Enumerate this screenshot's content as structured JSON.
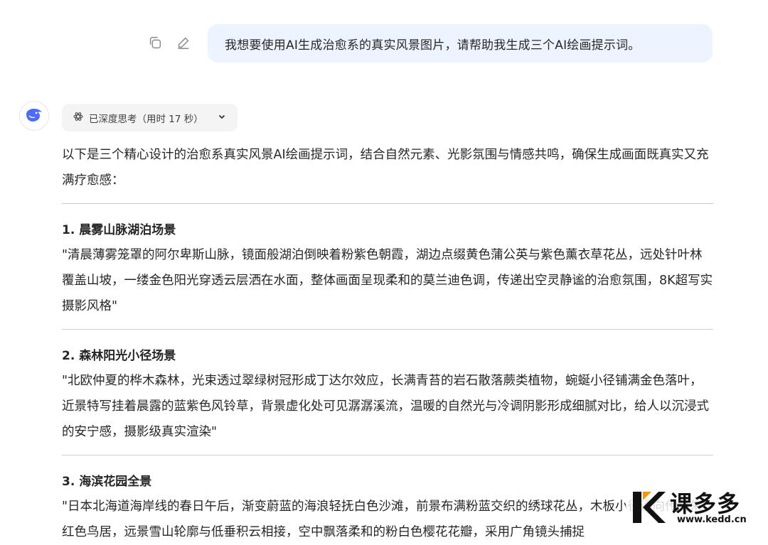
{
  "user_message": {
    "text": "我想要使用AI生成治愈系的真实风景图片，请帮助我生成三个AI绘画提示词。",
    "copy_icon": "copy-icon",
    "edit_icon": "edit-icon"
  },
  "assistant": {
    "avatar_icon": "whale-logo-icon",
    "thinking_label": "已深度思考（用时 17 秒）",
    "intro": "以下是三个精心设计的治愈系真实风景AI绘画提示词，结合自然元素、光影氛围与情感共鸣，确保生成画面既真实又充满疗愈感：",
    "sections": [
      {
        "title": "1. 晨雾山脉湖泊场景",
        "body": "\"清晨薄雾笼罩的阿尔卑斯山脉，镜面般湖泊倒映着粉紫色朝霞，湖边点缀黄色蒲公英与紫色薰衣草花丛，远处针叶林覆盖山坡，一缕金色阳光穿透云层洒在水面，整体画面呈现柔和的莫兰迪色调，传递出空灵静谧的治愈氛围，8K超写实摄影风格\""
      },
      {
        "title": "2. 森林阳光小径场景",
        "body": "\"北欧仲夏的桦木森林，光束透过翠绿树冠形成丁达尔效应，长满青苔的岩石散落蕨类植物，蜿蜒小径铺满金色落叶，近景特写挂着晨露的蓝紫色风铃草，背景虚化处可见潺潺溪流，温暖的自然光与冷调阴影形成细腻对比，给人以沉浸式的安宁感，摄影级真实渲染\""
      },
      {
        "title": "3. 海滨花园全景",
        "body": "\"日本北海道海岸线的春日午后，渐变蔚蓝的海浪轻抚白色沙滩，前景布满粉蓝交织的绣球花丛，木板小径通向传统朱红色鸟居，远景雪山轮廓与低垂积云相接，空中飘落柔和的粉白色樱花花瓣，采用广角镜头捕捉"
      }
    ]
  },
  "watermark": {
    "name": "课多多",
    "url": "www.kedd.cn"
  }
}
